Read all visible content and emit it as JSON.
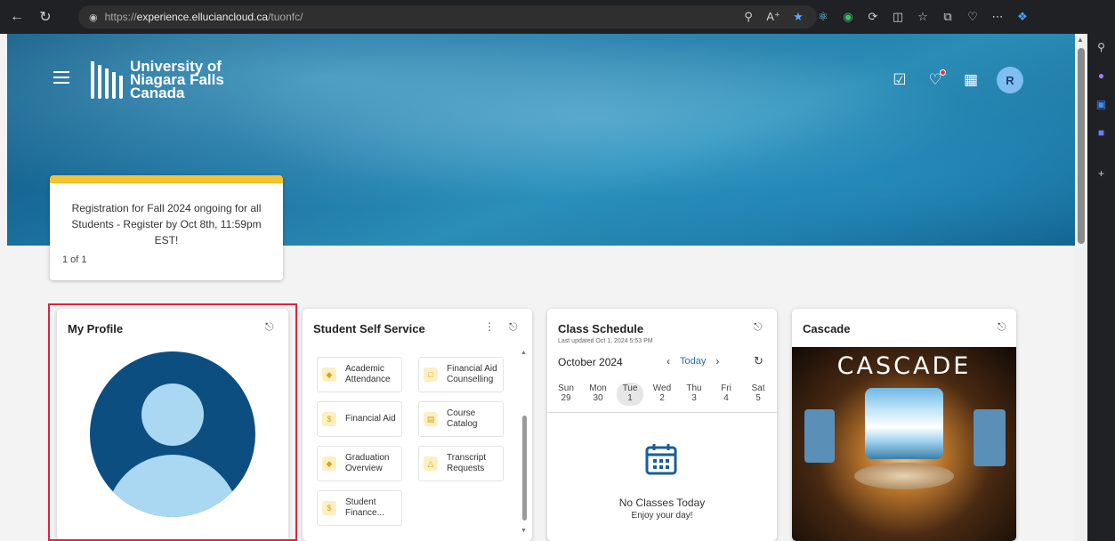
{
  "browser": {
    "url_scheme": "https://",
    "url_host": "experience.elluciancloud.ca",
    "url_path": "/tuonfc/"
  },
  "header": {
    "logo_line1": "University of",
    "logo_line2": "Niagara Falls",
    "logo_line3": "Canada",
    "avatar_initial": "R"
  },
  "notice": {
    "text": "Registration for Fall 2024 ongoing for all Students - Register by Oct 8th, 11:59pm EST!",
    "counter": "1 of 1"
  },
  "cards": {
    "profile": {
      "title": "My Profile"
    },
    "self_service": {
      "title": "Student Self Service",
      "tiles": [
        {
          "label": "Academic Attendance",
          "icon": "graduation-cap-icon"
        },
        {
          "label": "Financial Aid Counselling",
          "icon": "chat-icon"
        },
        {
          "label": "Financial Aid",
          "icon": "dollar-icon"
        },
        {
          "label": "Course Catalog",
          "icon": "book-icon"
        },
        {
          "label": "Graduation Overview",
          "icon": "graduation-cap-icon"
        },
        {
          "label": "Transcript Requests",
          "icon": "alert-icon"
        },
        {
          "label": "Student Finance...",
          "icon": "dollar-icon"
        }
      ]
    },
    "schedule": {
      "title": "Class Schedule",
      "updated": "Last updated Oct 1, 2024 5:53 PM",
      "month": "October 2024",
      "today_label": "Today",
      "days": [
        {
          "name": "Sun",
          "num": "29"
        },
        {
          "name": "Mon",
          "num": "30"
        },
        {
          "name": "Tue",
          "num": "1"
        },
        {
          "name": "Wed",
          "num": "2"
        },
        {
          "name": "Thu",
          "num": "3"
        },
        {
          "name": "Fri",
          "num": "4"
        },
        {
          "name": "Sat",
          "num": "5"
        }
      ],
      "selected_day": "Tue",
      "empty_title": "No Classes Today",
      "empty_sub": "Enjoy your day!"
    },
    "cascade": {
      "title": "Cascade",
      "image_word": "CASCADE"
    }
  },
  "colors": {
    "highlight": "#e0233d",
    "notice_accent": "#f4c430",
    "link": "#2a6ebb",
    "tile_icon": "#d9a21b",
    "avatar_dark": "#0d4e80",
    "avatar_light": "#aad8f3"
  }
}
